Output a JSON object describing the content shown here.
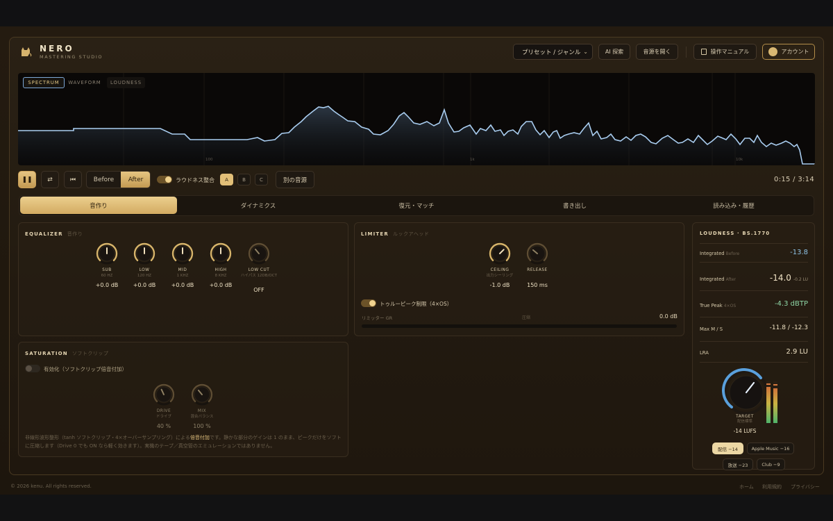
{
  "brand": {
    "name": "NERO",
    "subtitle": "MASTERING STUDIO"
  },
  "header": {
    "preset_select": "プリセット / ジャンル",
    "ai_search": "AI 探索",
    "open_audio": "音源を開く",
    "manual": "操作マニュアル",
    "account": "アカウント"
  },
  "analyzer": {
    "tabs": [
      "SPECTRUM",
      "WAVEFORM",
      "LOUDNESS"
    ],
    "active_tab": "SPECTRUM",
    "axis_labels": [
      "100",
      "1k",
      "10k"
    ]
  },
  "transport": {
    "before": "Before",
    "after": "After",
    "loudness_match": "ラウドネス整合",
    "slots": [
      "A",
      "B",
      "C"
    ],
    "active_slot": "A",
    "alt_source": "別の音源",
    "time": "0:15 / 3:14"
  },
  "tabs": [
    "音作り",
    "ダイナミクス",
    "復元・マッチ",
    "書き出し",
    "読み込み・履歴"
  ],
  "equalizer": {
    "title": "EQUALIZER",
    "subtitle": "音作り",
    "knobs": [
      {
        "name": "SUB",
        "sub": "60 HZ",
        "value": "+0.0 dB"
      },
      {
        "name": "LOW",
        "sub": "120 HZ",
        "value": "+0.0 dB"
      },
      {
        "name": "MID",
        "sub": "1 KHZ",
        "value": "+0.0 dB"
      },
      {
        "name": "HIGH",
        "sub": "8 KHZ",
        "value": "+0.0 dB"
      },
      {
        "name": "LOW CUT",
        "sub": "ハイパス 12DB/OCT",
        "value": "OFF"
      }
    ]
  },
  "limiter": {
    "title": "LIMITER",
    "subtitle": "ルックアヘッド",
    "knobs": [
      {
        "name": "CEILING",
        "sub": "出力シーリング",
        "value": "-1.0 dB"
      },
      {
        "name": "RELEASE",
        "sub": "",
        "value": "150 ms"
      }
    ],
    "true_peak": "トゥルーピーク制限（4×OS）",
    "gr_label": "リミッター GR",
    "gr_mid": "圧縮",
    "gr_value": "0.0 dB"
  },
  "saturation": {
    "title": "SATURATION",
    "subtitle": "ソフトクリップ",
    "enable": "有効化（ソフトクリップ倍音付加）",
    "knobs": [
      {
        "name": "DRIVE",
        "sub": "ドライブ",
        "value": "40 %"
      },
      {
        "name": "MIX",
        "sub": "混合バランス",
        "value": "100 %"
      }
    ],
    "desc_before": "非線形波形整形（tanh ソフトクリップ・4×オーバーサンプリング）による",
    "desc_bold": "倍音付加",
    "desc_after": "です。静かな部分のゲインは 1 のまま、ピークだけをソフトに圧縮します（Drive 0 でも ON なら軽く効きます）。実機のテープ／真空管のエミュレーションではありません。"
  },
  "loudness": {
    "title": "LOUDNESS · BS.1770",
    "rows": [
      {
        "name": "Integrated",
        "tag": "Before",
        "value": "-13.8",
        "extra": "",
        "color": "#8fc3e6"
      },
      {
        "name": "Integrated",
        "tag": "After",
        "value": "-14.0",
        "extra": "-0.2 LU",
        "color": "#f2e4c4"
      },
      {
        "name": "True Peak",
        "tag": "4×OS",
        "value": "-4.3 dBTP",
        "extra": "",
        "color": "#8fd6a6"
      },
      {
        "name": "Max M / S",
        "tag": "",
        "value": "-11.8 / -12.3",
        "extra": "",
        "color": "#efe2c4"
      },
      {
        "name": "LRA",
        "tag": "",
        "value": "2.9 LU",
        "extra": "",
        "color": "#efe2c4"
      }
    ],
    "target_label": "TARGET",
    "target_sub": "配信標準",
    "target_value": "-14 LUFS",
    "chips": [
      "配信 −14",
      "Apple Music −16",
      "放送 −23",
      "Club −9"
    ]
  },
  "footer": {
    "copyright": "© 2026 kenu. All rights reserved.",
    "links": [
      "ホーム",
      "利用規約",
      "プライバシー"
    ]
  },
  "colors": {
    "accent": "#e3c07a",
    "spectrum": "#9ec4ec",
    "background": "#221a10"
  }
}
